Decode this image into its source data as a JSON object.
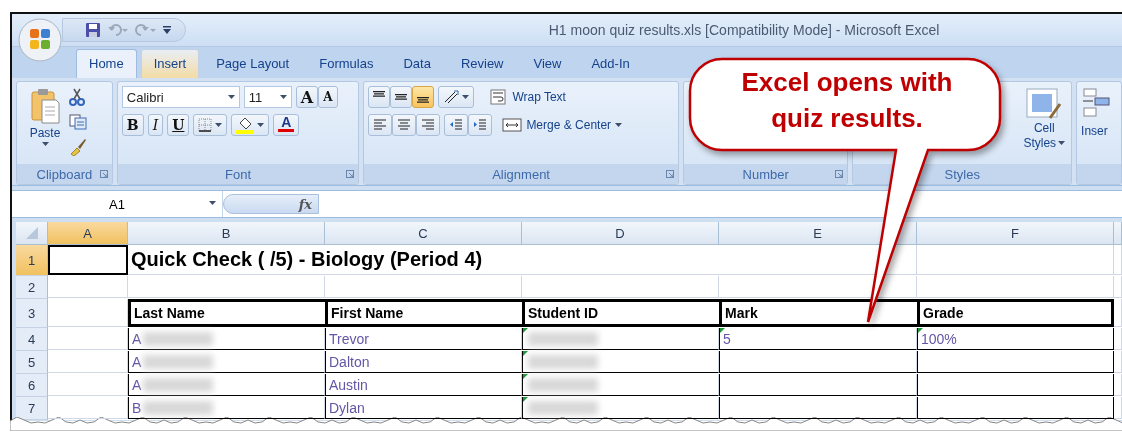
{
  "window": {
    "title": "H1 moon quiz results.xls  [Compatibility Mode] - Microsoft Excel"
  },
  "tabs": [
    {
      "label": "Home",
      "selected": true,
      "highlighted": false
    },
    {
      "label": "Insert",
      "selected": false,
      "highlighted": true
    },
    {
      "label": "Page Layout",
      "selected": false,
      "highlighted": false
    },
    {
      "label": "Formulas",
      "selected": false,
      "highlighted": false
    },
    {
      "label": "Data",
      "selected": false,
      "highlighted": false
    },
    {
      "label": "Review",
      "selected": false,
      "highlighted": false
    },
    {
      "label": "View",
      "selected": false,
      "highlighted": false
    },
    {
      "label": "Add-In",
      "selected": false,
      "highlighted": false
    }
  ],
  "ribbon": {
    "clipboard": {
      "paste": "Paste",
      "label": "Clipboard"
    },
    "font": {
      "font_name": "Calibri",
      "font_size": "11",
      "grow": "A",
      "shrink": "A",
      "bold": "B",
      "italic": "I",
      "underline": "U",
      "font_color": "A",
      "label": "Font"
    },
    "alignment": {
      "vertical": [
        {
          "selected": false
        },
        {
          "selected": false
        },
        {
          "selected": true
        }
      ],
      "wrap_text": "Wrap Text",
      "merge_center": "Merge & Center",
      "label": "Alignment"
    },
    "number": {
      "label": "Number"
    },
    "styles": {
      "cell_styles": [
        "Cell",
        "Styles"
      ],
      "label": "Styles"
    },
    "cells": {
      "insert": "Inser"
    }
  },
  "formula_bar": {
    "name_box": "A1",
    "fx": "fx"
  },
  "sheet": {
    "columns": [
      {
        "label": "A",
        "selected": true
      },
      {
        "label": "B",
        "selected": false
      },
      {
        "label": "C",
        "selected": false
      },
      {
        "label": "D",
        "selected": false
      },
      {
        "label": "E",
        "selected": false
      },
      {
        "label": "F",
        "selected": false
      }
    ],
    "rows": [
      {
        "number": "1",
        "selected": true,
        "kind": "title",
        "title": "Quick Check ( /5) - Biology (Period 4)"
      },
      {
        "number": "2",
        "selected": false,
        "kind": "blank"
      },
      {
        "number": "3",
        "selected": false,
        "kind": "header",
        "cells": [
          "Last Name",
          "First Name",
          "Student ID",
          "Mark",
          "Grade"
        ]
      },
      {
        "number": "4",
        "selected": false,
        "kind": "data",
        "cells": [
          {
            "text": "A",
            "redacted": true,
            "flagged": false
          },
          {
            "text": "Trevor",
            "redacted": false,
            "flagged": false
          },
          {
            "text": "",
            "redacted": true,
            "flagged": true
          },
          {
            "text": "5",
            "redacted": false,
            "flagged": true
          },
          {
            "text": "100%",
            "redacted": false,
            "flagged": true
          }
        ]
      },
      {
        "number": "5",
        "selected": false,
        "kind": "data",
        "cells": [
          {
            "text": "A",
            "redacted": true,
            "flagged": false
          },
          {
            "text": "Dalton",
            "redacted": false,
            "flagged": false
          },
          {
            "text": "",
            "redacted": true,
            "flagged": true
          },
          {
            "text": "",
            "redacted": false,
            "flagged": false
          },
          {
            "text": "",
            "redacted": false,
            "flagged": false
          }
        ]
      },
      {
        "number": "6",
        "selected": false,
        "kind": "data",
        "cells": [
          {
            "text": "A",
            "redacted": true,
            "flagged": false
          },
          {
            "text": "Austin",
            "redacted": false,
            "flagged": false
          },
          {
            "text": "",
            "redacted": true,
            "flagged": true
          },
          {
            "text": "",
            "redacted": false,
            "flagged": false
          },
          {
            "text": "",
            "redacted": false,
            "flagged": false
          }
        ]
      },
      {
        "number": "7",
        "selected": false,
        "kind": "data",
        "cells": [
          {
            "text": "B",
            "redacted": true,
            "flagged": false
          },
          {
            "text": "Dylan",
            "redacted": false,
            "flagged": false
          },
          {
            "text": "",
            "redacted": true,
            "flagged": true
          },
          {
            "text": "",
            "redacted": false,
            "flagged": false
          },
          {
            "text": "",
            "redacted": false,
            "flagged": false
          }
        ]
      }
    ]
  },
  "callout": {
    "text": "Excel opens with quiz results."
  }
}
